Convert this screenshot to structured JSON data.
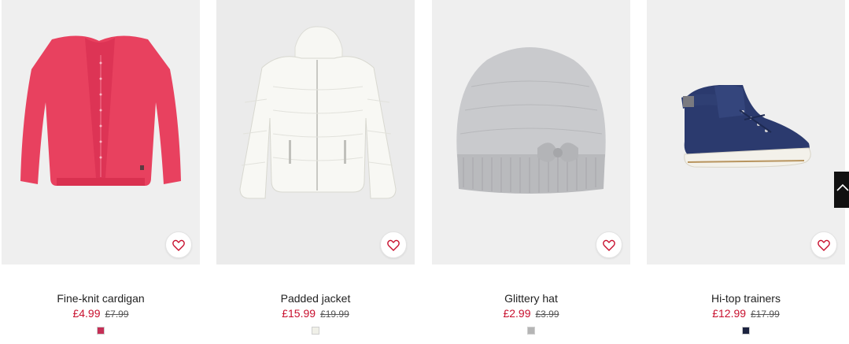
{
  "products": [
    {
      "name": "Fine-knit cardigan",
      "price": "£4.99",
      "old_price": "£7.99",
      "swatch_color": "#c52f56",
      "favorite_icon": "heart-outline-icon"
    },
    {
      "name": "Padded jacket",
      "price": "£15.99",
      "old_price": "£19.99",
      "swatch_color": "#f0f0e8",
      "favorite_icon": "heart-outline-icon"
    },
    {
      "name": "Glittery hat",
      "price": "£2.99",
      "old_price": "£3.99",
      "swatch_color": "#b5b5b5",
      "favorite_icon": "heart-outline-icon"
    },
    {
      "name": "Hi-top trainers",
      "price": "£12.99",
      "old_price": "£17.99",
      "swatch_color": "#1c2340",
      "favorite_icon": "heart-outline-icon"
    }
  ],
  "colors": {
    "sale_price": "#c8102e",
    "favorite_heart": "#c8102e",
    "image_background": "#efefef"
  },
  "scroll_top_icon": "chevron-up-icon"
}
